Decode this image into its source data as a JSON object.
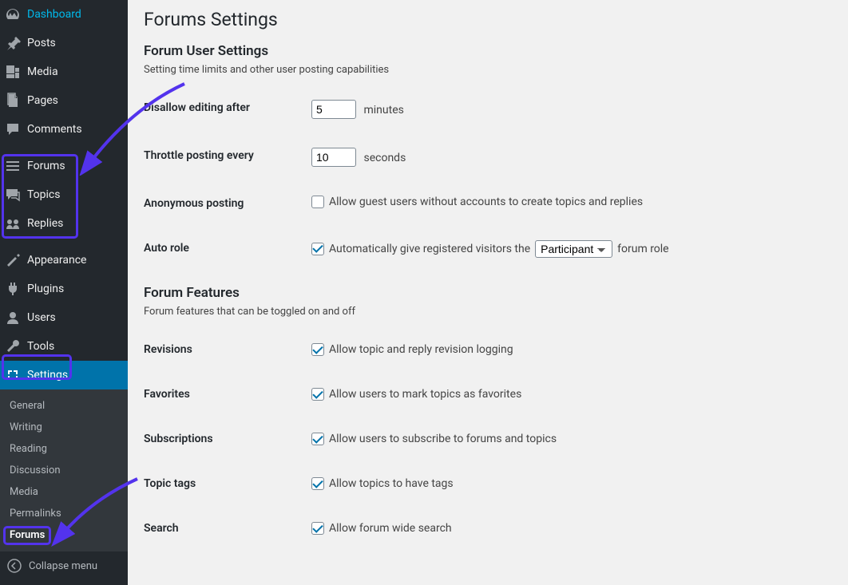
{
  "sidebar": {
    "items": [
      {
        "label": "Dashboard",
        "icon": "dashboard"
      },
      {
        "label": "Posts",
        "icon": "pin"
      },
      {
        "label": "Media",
        "icon": "media"
      },
      {
        "label": "Pages",
        "icon": "pages"
      },
      {
        "label": "Comments",
        "icon": "comments"
      },
      {
        "label": "Forums",
        "icon": "forums"
      },
      {
        "label": "Topics",
        "icon": "topics"
      },
      {
        "label": "Replies",
        "icon": "replies"
      },
      {
        "label": "Appearance",
        "icon": "appearance"
      },
      {
        "label": "Plugins",
        "icon": "plugins"
      },
      {
        "label": "Users",
        "icon": "users"
      },
      {
        "label": "Tools",
        "icon": "tools"
      },
      {
        "label": "Settings",
        "icon": "settings",
        "current": true
      }
    ],
    "submenu": [
      {
        "label": "General"
      },
      {
        "label": "Writing"
      },
      {
        "label": "Reading"
      },
      {
        "label": "Discussion"
      },
      {
        "label": "Media"
      },
      {
        "label": "Permalinks"
      },
      {
        "label": "Forums",
        "current": true
      }
    ],
    "collapse_label": "Collapse menu"
  },
  "page": {
    "title": "Forums Settings",
    "user_settings": {
      "heading": "Forum User Settings",
      "description": "Setting time limits and other user posting capabilities",
      "disallow_editing": {
        "label": "Disallow editing after",
        "value": "5",
        "unit": "minutes"
      },
      "throttle": {
        "label": "Throttle posting every",
        "value": "10",
        "unit": "seconds"
      },
      "anonymous": {
        "label": "Anonymous posting",
        "checkbox_label": "Allow guest users without accounts to create topics and replies",
        "checked": false
      },
      "auto_role": {
        "label": "Auto role",
        "checkbox_label_before": "Automatically give registered visitors the",
        "checkbox_label_after": "forum role",
        "checked": true,
        "role_selected": "Participant"
      }
    },
    "forum_features": {
      "heading": "Forum Features",
      "description": "Forum features that can be toggled on and off",
      "rows": [
        {
          "label": "Revisions",
          "text": "Allow topic and reply revision logging",
          "checked": true
        },
        {
          "label": "Favorites",
          "text": "Allow users to mark topics as favorites",
          "checked": true
        },
        {
          "label": "Subscriptions",
          "text": "Allow users to subscribe to forums and topics",
          "checked": true
        },
        {
          "label": "Topic tags",
          "text": "Allow topics to have tags",
          "checked": true
        },
        {
          "label": "Search",
          "text": "Allow forum wide search",
          "checked": true
        }
      ]
    }
  }
}
